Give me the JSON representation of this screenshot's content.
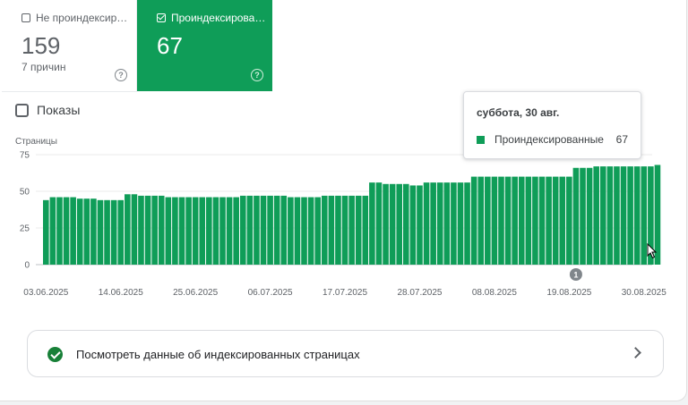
{
  "tiles": {
    "unindexed": {
      "label": "Не проиндексир…",
      "value": "159",
      "sub": "7 причин",
      "help": "?"
    },
    "indexed": {
      "label": "Проиндексирова…",
      "value": "67",
      "help": "?"
    }
  },
  "impressions_label": "Показы",
  "tooltip": {
    "date": "суббота, 30 авг.",
    "series": "Проиндексированные",
    "value": "67"
  },
  "link_row": {
    "label": "Посмотреть данные об индексированных страницах"
  },
  "colors": {
    "accent": "#0f9d58"
  },
  "chart_data": {
    "type": "bar",
    "ylabel": "Страницы",
    "ylim": [
      0,
      75
    ],
    "yticks": [
      0,
      25,
      50,
      75
    ],
    "xtick_labels": [
      "03.06.2025",
      "14.06.2025",
      "25.06.2025",
      "06.07.2025",
      "17.07.2025",
      "28.07.2025",
      "08.08.2025",
      "19.08.2025",
      "30.08.2025"
    ],
    "xtick_index": [
      0,
      11,
      22,
      33,
      44,
      55,
      66,
      77,
      88
    ],
    "annotations": [
      {
        "index": 78,
        "label": "1"
      }
    ],
    "series": [
      {
        "name": "Проиндексированные",
        "color": "#0f9d58",
        "values": [
          44,
          46,
          46,
          46,
          46,
          45,
          45,
          45,
          44,
          44,
          44,
          44,
          48,
          48,
          47,
          47,
          47,
          47,
          46,
          46,
          46,
          46,
          46,
          46,
          46,
          46,
          46,
          46,
          46,
          47,
          47,
          47,
          47,
          47,
          47,
          47,
          46,
          46,
          46,
          46,
          46,
          47,
          47,
          47,
          47,
          47,
          47,
          47,
          56,
          56,
          55,
          55,
          55,
          55,
          54,
          54,
          56,
          56,
          56,
          56,
          56,
          56,
          56,
          60,
          60,
          60,
          60,
          60,
          60,
          60,
          60,
          60,
          60,
          60,
          60,
          60,
          60,
          60,
          66,
          66,
          66,
          67,
          67,
          67,
          67,
          67,
          67,
          67,
          67,
          67,
          68
        ]
      }
    ]
  }
}
